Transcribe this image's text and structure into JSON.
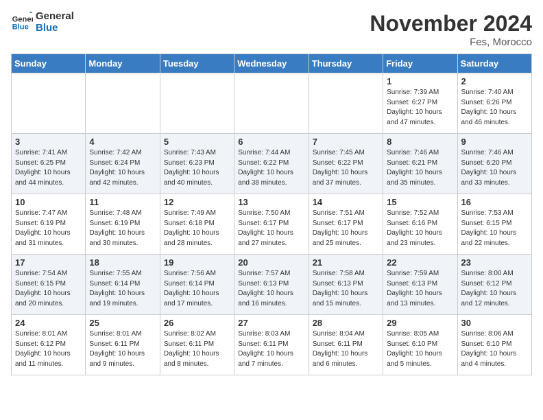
{
  "logo": {
    "line1": "General",
    "line2": "Blue"
  },
  "title": "November 2024",
  "location": "Fes, Morocco",
  "days_of_week": [
    "Sunday",
    "Monday",
    "Tuesday",
    "Wednesday",
    "Thursday",
    "Friday",
    "Saturday"
  ],
  "weeks": [
    [
      {
        "day": "",
        "info": ""
      },
      {
        "day": "",
        "info": ""
      },
      {
        "day": "",
        "info": ""
      },
      {
        "day": "",
        "info": ""
      },
      {
        "day": "",
        "info": ""
      },
      {
        "day": "1",
        "info": "Sunrise: 7:39 AM\nSunset: 6:27 PM\nDaylight: 10 hours and 47 minutes."
      },
      {
        "day": "2",
        "info": "Sunrise: 7:40 AM\nSunset: 6:26 PM\nDaylight: 10 hours and 46 minutes."
      }
    ],
    [
      {
        "day": "3",
        "info": "Sunrise: 7:41 AM\nSunset: 6:25 PM\nDaylight: 10 hours and 44 minutes."
      },
      {
        "day": "4",
        "info": "Sunrise: 7:42 AM\nSunset: 6:24 PM\nDaylight: 10 hours and 42 minutes."
      },
      {
        "day": "5",
        "info": "Sunrise: 7:43 AM\nSunset: 6:23 PM\nDaylight: 10 hours and 40 minutes."
      },
      {
        "day": "6",
        "info": "Sunrise: 7:44 AM\nSunset: 6:22 PM\nDaylight: 10 hours and 38 minutes."
      },
      {
        "day": "7",
        "info": "Sunrise: 7:45 AM\nSunset: 6:22 PM\nDaylight: 10 hours and 37 minutes."
      },
      {
        "day": "8",
        "info": "Sunrise: 7:46 AM\nSunset: 6:21 PM\nDaylight: 10 hours and 35 minutes."
      },
      {
        "day": "9",
        "info": "Sunrise: 7:46 AM\nSunset: 6:20 PM\nDaylight: 10 hours and 33 minutes."
      }
    ],
    [
      {
        "day": "10",
        "info": "Sunrise: 7:47 AM\nSunset: 6:19 PM\nDaylight: 10 hours and 31 minutes."
      },
      {
        "day": "11",
        "info": "Sunrise: 7:48 AM\nSunset: 6:19 PM\nDaylight: 10 hours and 30 minutes."
      },
      {
        "day": "12",
        "info": "Sunrise: 7:49 AM\nSunset: 6:18 PM\nDaylight: 10 hours and 28 minutes."
      },
      {
        "day": "13",
        "info": "Sunrise: 7:50 AM\nSunset: 6:17 PM\nDaylight: 10 hours and 27 minutes."
      },
      {
        "day": "14",
        "info": "Sunrise: 7:51 AM\nSunset: 6:17 PM\nDaylight: 10 hours and 25 minutes."
      },
      {
        "day": "15",
        "info": "Sunrise: 7:52 AM\nSunset: 6:16 PM\nDaylight: 10 hours and 23 minutes."
      },
      {
        "day": "16",
        "info": "Sunrise: 7:53 AM\nSunset: 6:15 PM\nDaylight: 10 hours and 22 minutes."
      }
    ],
    [
      {
        "day": "17",
        "info": "Sunrise: 7:54 AM\nSunset: 6:15 PM\nDaylight: 10 hours and 20 minutes."
      },
      {
        "day": "18",
        "info": "Sunrise: 7:55 AM\nSunset: 6:14 PM\nDaylight: 10 hours and 19 minutes."
      },
      {
        "day": "19",
        "info": "Sunrise: 7:56 AM\nSunset: 6:14 PM\nDaylight: 10 hours and 17 minutes."
      },
      {
        "day": "20",
        "info": "Sunrise: 7:57 AM\nSunset: 6:13 PM\nDaylight: 10 hours and 16 minutes."
      },
      {
        "day": "21",
        "info": "Sunrise: 7:58 AM\nSunset: 6:13 PM\nDaylight: 10 hours and 15 minutes."
      },
      {
        "day": "22",
        "info": "Sunrise: 7:59 AM\nSunset: 6:13 PM\nDaylight: 10 hours and 13 minutes."
      },
      {
        "day": "23",
        "info": "Sunrise: 8:00 AM\nSunset: 6:12 PM\nDaylight: 10 hours and 12 minutes."
      }
    ],
    [
      {
        "day": "24",
        "info": "Sunrise: 8:01 AM\nSunset: 6:12 PM\nDaylight: 10 hours and 11 minutes."
      },
      {
        "day": "25",
        "info": "Sunrise: 8:01 AM\nSunset: 6:11 PM\nDaylight: 10 hours and 9 minutes."
      },
      {
        "day": "26",
        "info": "Sunrise: 8:02 AM\nSunset: 6:11 PM\nDaylight: 10 hours and 8 minutes."
      },
      {
        "day": "27",
        "info": "Sunrise: 8:03 AM\nSunset: 6:11 PM\nDaylight: 10 hours and 7 minutes."
      },
      {
        "day": "28",
        "info": "Sunrise: 8:04 AM\nSunset: 6:11 PM\nDaylight: 10 hours and 6 minutes."
      },
      {
        "day": "29",
        "info": "Sunrise: 8:05 AM\nSunset: 6:10 PM\nDaylight: 10 hours and 5 minutes."
      },
      {
        "day": "30",
        "info": "Sunrise: 8:06 AM\nSunset: 6:10 PM\nDaylight: 10 hours and 4 minutes."
      }
    ]
  ]
}
